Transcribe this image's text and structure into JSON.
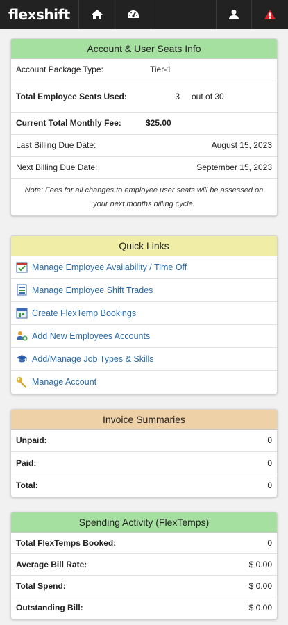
{
  "app": {
    "brand": "flexshift"
  },
  "nav": {
    "home_icon": "home-icon",
    "dashboard_icon": "dashboard-icon",
    "user_icon": "user-icon",
    "alert_icon": "alert-icon"
  },
  "account": {
    "title": "Account & User Seats Info",
    "package_label": "Account Package Type:",
    "package_value": "Tier-1",
    "seats_label": "Total Employee Seats Used:",
    "seats_used": "3",
    "seats_total": "out of 30",
    "fee_label": "Current Total Monthly Fee:",
    "fee_value": "$25.00",
    "last_billing_label": "Last Billing Due Date:",
    "last_billing_value": "August 15, 2023",
    "next_billing_label": "Next Billing Due Date:",
    "next_billing_value": "September 15, 2023",
    "note": "Note: Fees for all changes to employee user seats will be assessed on your next months billing cycle."
  },
  "quick_links": {
    "title": "Quick Links",
    "items": [
      {
        "label": "Manage Employee Availability / Time Off",
        "icon": "calendar-check-icon"
      },
      {
        "label": "Manage Employee Shift Trades",
        "icon": "shift-trade-icon"
      },
      {
        "label": "Create FlexTemp Bookings",
        "icon": "booking-icon"
      },
      {
        "label": "Add New Employees Accounts",
        "icon": "add-users-icon"
      },
      {
        "label": "Add/Manage Job Types & Skills",
        "icon": "graduation-cap-icon"
      },
      {
        "label": "Manage Account",
        "icon": "key-icon"
      }
    ]
  },
  "invoices": {
    "title": "Invoice Summaries",
    "rows": [
      {
        "label": "Unpaid:",
        "value": "0"
      },
      {
        "label": "Paid:",
        "value": "0"
      },
      {
        "label": "Total:",
        "value": "0"
      }
    ]
  },
  "spending": {
    "title": "Spending Activity (FlexTemps)",
    "rows": [
      {
        "label": "Total FlexTemps Booked:",
        "value": "0"
      },
      {
        "label": "Average Bill Rate:",
        "value": "$ 0.00"
      },
      {
        "label": "Total Spend:",
        "value": "$ 0.00"
      },
      {
        "label": "Outstanding Bill:",
        "value": "$ 0.00"
      }
    ]
  },
  "colors": {
    "header_green": "#a5e0a1",
    "header_yellow": "#efeda6",
    "header_tan": "#efd1a8",
    "link_blue": "#2a6aa8",
    "alert_red": "#d9262c",
    "topbar": "#222222"
  }
}
